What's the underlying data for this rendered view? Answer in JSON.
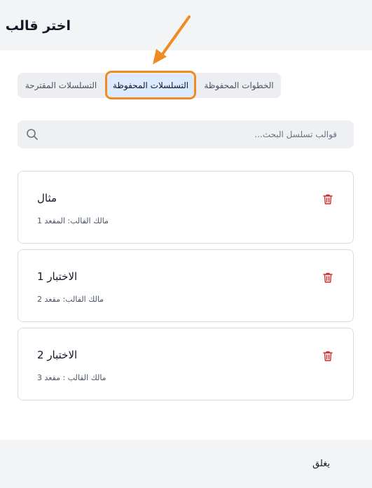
{
  "header": {
    "title": "اختر قالب"
  },
  "tabs": [
    {
      "label": "التسلسلات المقترحة",
      "active": false
    },
    {
      "label": "التسلسلات المحفوظة",
      "active": true
    },
    {
      "label": "الخطوات المحفوظة",
      "active": false
    }
  ],
  "annotation": {
    "color": "#f08a24"
  },
  "search": {
    "placeholder": "قوالب تسلسل البحث...",
    "value": ""
  },
  "templates": [
    {
      "name": "مثال",
      "owner": "مالك القالب: المقعد 1"
    },
    {
      "name": "الاختبار 1",
      "owner": "مالك القالب: مقعد 2"
    },
    {
      "name": "الاختبار 2",
      "owner": "مالك القالب : مقعد 3"
    }
  ],
  "footer": {
    "close_label": "يغلق"
  },
  "colors": {
    "accent": "#dbeafe",
    "delete": "#dc2626"
  }
}
